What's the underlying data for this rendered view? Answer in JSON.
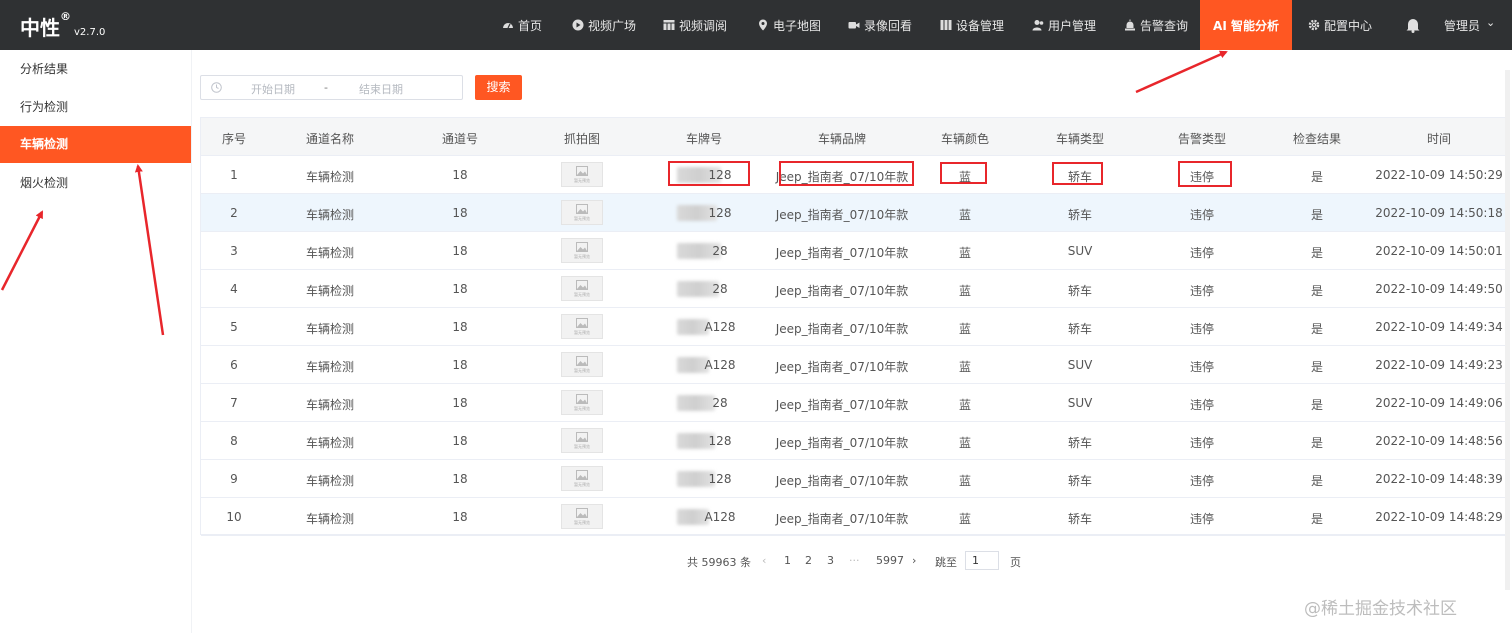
{
  "header": {
    "brand": "中性",
    "brand_mark": "®",
    "version": "v2.7.0",
    "nav": [
      {
        "label": "首页",
        "icon": "dashboard-icon"
      },
      {
        "label": "视频广场",
        "icon": "play-icon"
      },
      {
        "label": "视频调阅",
        "icon": "grid-icon"
      },
      {
        "label": "电子地图",
        "icon": "map-pin-icon"
      },
      {
        "label": "录像回看",
        "icon": "camera-icon"
      },
      {
        "label": "设备管理",
        "icon": "bars-icon"
      },
      {
        "label": "用户管理",
        "icon": "users-icon"
      },
      {
        "label": "告警查询",
        "icon": "alarm-icon"
      },
      {
        "label": "AI 智能分析",
        "icon": "",
        "active": true
      },
      {
        "label": "配置中心",
        "icon": "gear-icon"
      }
    ],
    "bell_icon": "bell-icon",
    "user": "管理员",
    "user_caret": "⌄"
  },
  "sidebar": {
    "items": [
      {
        "label": "分析结果"
      },
      {
        "label": "行为检测"
      },
      {
        "label": "车辆检测",
        "active": true
      },
      {
        "label": "烟火检测"
      }
    ]
  },
  "filter": {
    "start_placeholder": "开始日期",
    "separator": "-",
    "end_placeholder": "结束日期",
    "search_label": "搜索"
  },
  "table": {
    "columns": [
      "序号",
      "通道名称",
      "通道号",
      "抓拍图",
      "车牌号",
      "车辆品牌",
      "车辆颜色",
      "车辆类型",
      "告警类型",
      "检查结果",
      "时间"
    ],
    "thumb_text": "暂无预览",
    "rows": [
      {
        "no": "1",
        "channel_name": "车辆检测",
        "channel_no": "18",
        "plate": "128",
        "brand": "Jeep_指南者_07/10年款",
        "color": "蓝",
        "type": "轿车",
        "alarm": "违停",
        "result": "是",
        "time": "2022-10-09 14:50:29"
      },
      {
        "no": "2",
        "channel_name": "车辆检测",
        "channel_no": "18",
        "plate": "128",
        "brand": "Jeep_指南者_07/10年款",
        "color": "蓝",
        "type": "轿车",
        "alarm": "违停",
        "result": "是",
        "time": "2022-10-09 14:50:18"
      },
      {
        "no": "3",
        "channel_name": "车辆检测",
        "channel_no": "18",
        "plate": "28",
        "brand": "Jeep_指南者_07/10年款",
        "color": "蓝",
        "type": "SUV",
        "alarm": "违停",
        "result": "是",
        "time": "2022-10-09 14:50:01"
      },
      {
        "no": "4",
        "channel_name": "车辆检测",
        "channel_no": "18",
        "plate": "28",
        "brand": "Jeep_指南者_07/10年款",
        "color": "蓝",
        "type": "轿车",
        "alarm": "违停",
        "result": "是",
        "time": "2022-10-09 14:49:50"
      },
      {
        "no": "5",
        "channel_name": "车辆检测",
        "channel_no": "18",
        "plate": "A128",
        "brand": "Jeep_指南者_07/10年款",
        "color": "蓝",
        "type": "轿车",
        "alarm": "违停",
        "result": "是",
        "time": "2022-10-09 14:49:34"
      },
      {
        "no": "6",
        "channel_name": "车辆检测",
        "channel_no": "18",
        "plate": "A128",
        "brand": "Jeep_指南者_07/10年款",
        "color": "蓝",
        "type": "SUV",
        "alarm": "违停",
        "result": "是",
        "time": "2022-10-09 14:49:23"
      },
      {
        "no": "7",
        "channel_name": "车辆检测",
        "channel_no": "18",
        "plate": "28",
        "brand": "Jeep_指南者_07/10年款",
        "color": "蓝",
        "type": "SUV",
        "alarm": "违停",
        "result": "是",
        "time": "2022-10-09 14:49:06"
      },
      {
        "no": "8",
        "channel_name": "车辆检测",
        "channel_no": "18",
        "plate": "128",
        "brand": "Jeep_指南者_07/10年款",
        "color": "蓝",
        "type": "轿车",
        "alarm": "违停",
        "result": "是",
        "time": "2022-10-09 14:48:56"
      },
      {
        "no": "9",
        "channel_name": "车辆检测",
        "channel_no": "18",
        "plate": "128",
        "brand": "Jeep_指南者_07/10年款",
        "color": "蓝",
        "type": "轿车",
        "alarm": "违停",
        "result": "是",
        "time": "2022-10-09 14:48:39"
      },
      {
        "no": "10",
        "channel_name": "车辆检测",
        "channel_no": "18",
        "plate": "A128",
        "brand": "Jeep_指南者_07/10年款",
        "color": "蓝",
        "type": "轿车",
        "alarm": "违停",
        "result": "是",
        "time": "2022-10-09 14:48:29"
      }
    ]
  },
  "pagination": {
    "total": "共 59963 条",
    "prev": "‹",
    "pages": [
      "1",
      "2",
      "3"
    ],
    "current": "1",
    "ellipsis": "···",
    "last": "5997",
    "next": "›",
    "goto_label": "跳至",
    "goto_value": "1",
    "page_suffix": "页"
  },
  "watermark": "@稀土掘金技术社区",
  "colors": {
    "accent": "#ff5722",
    "topbar": "#2f3133",
    "highlight": "#e8262b"
  }
}
